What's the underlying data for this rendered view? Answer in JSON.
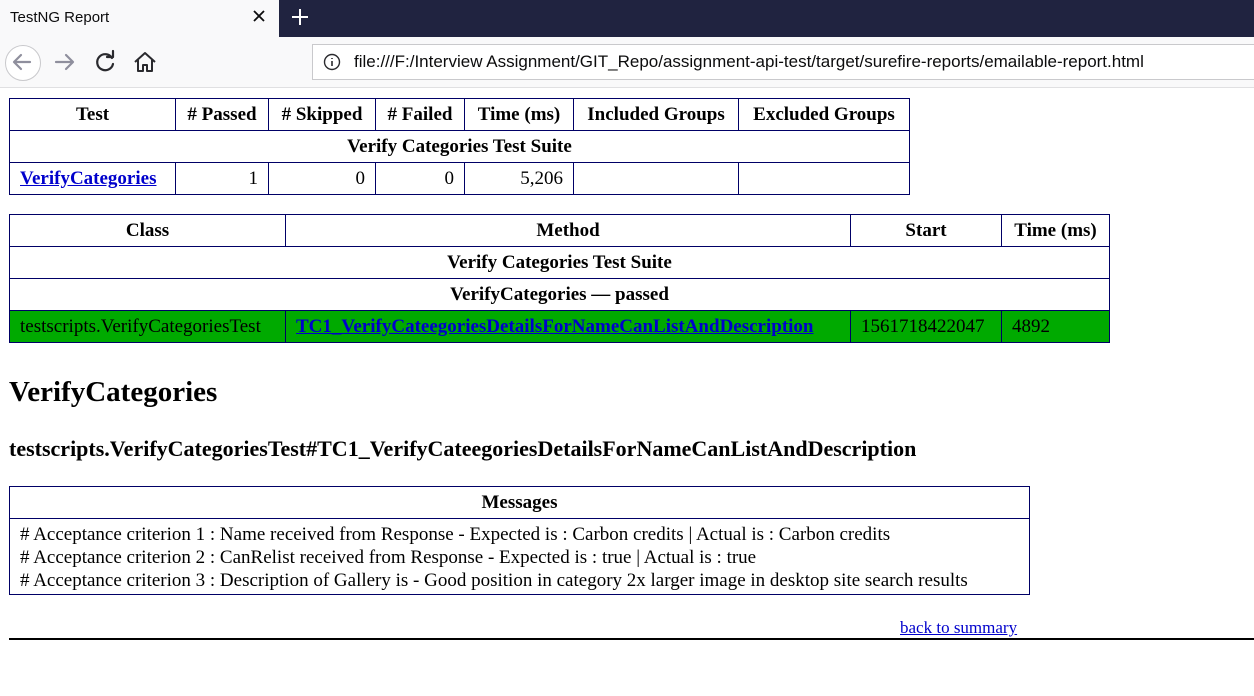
{
  "browser": {
    "tab_title": "TestNG Report",
    "url": "file:///F:/Interview Assignment/GIT_Repo/assignment-api-test/target/surefire-reports/emailable-report.html",
    "icons": [
      "close-icon",
      "plus-icon",
      "back-arrow-icon",
      "forward-arrow-icon",
      "reload-icon",
      "home-icon",
      "info-icon"
    ]
  },
  "summary": {
    "headers": [
      "Test",
      "# Passed",
      "# Skipped",
      "# Failed",
      "Time (ms)",
      "Included Groups",
      "Excluded Groups"
    ],
    "suite_name": "Verify Categories Test Suite",
    "row": {
      "test": "VerifyCategories",
      "passed": "1",
      "skipped": "0",
      "failed": "0",
      "time": "5,206",
      "included": "",
      "excluded": ""
    }
  },
  "methods": {
    "headers": [
      "Class",
      "Method",
      "Start",
      "Time (ms)"
    ],
    "suite_name": "Verify Categories Test Suite",
    "status_row": "VerifyCategories — passed",
    "row": {
      "class": "testscripts.VerifyCategoriesTest",
      "method": "TC1_VerifyCateegoriesDetailsForNameCanListAndDescription",
      "start": "1561718422047",
      "time": "4892"
    },
    "pass_color": "#00aa00"
  },
  "detail": {
    "test_heading": "VerifyCategories",
    "method_heading": "testscripts.VerifyCategoriesTest#TC1_VerifyCateegoriesDetailsForNameCanListAndDescription",
    "messages_header": "Messages",
    "messages": [
      "# Acceptance criterion 1 : Name received from Response - Expected is : Carbon credits | Actual is : Carbon credits",
      "# Acceptance criterion 2 : CanRelist received from Response - Expected is : true | Actual is : true",
      "# Acceptance criterion 3 : Description of Gallery is - Good position in category 2x larger image in desktop site search results"
    ],
    "back_link": "back to summary"
  }
}
